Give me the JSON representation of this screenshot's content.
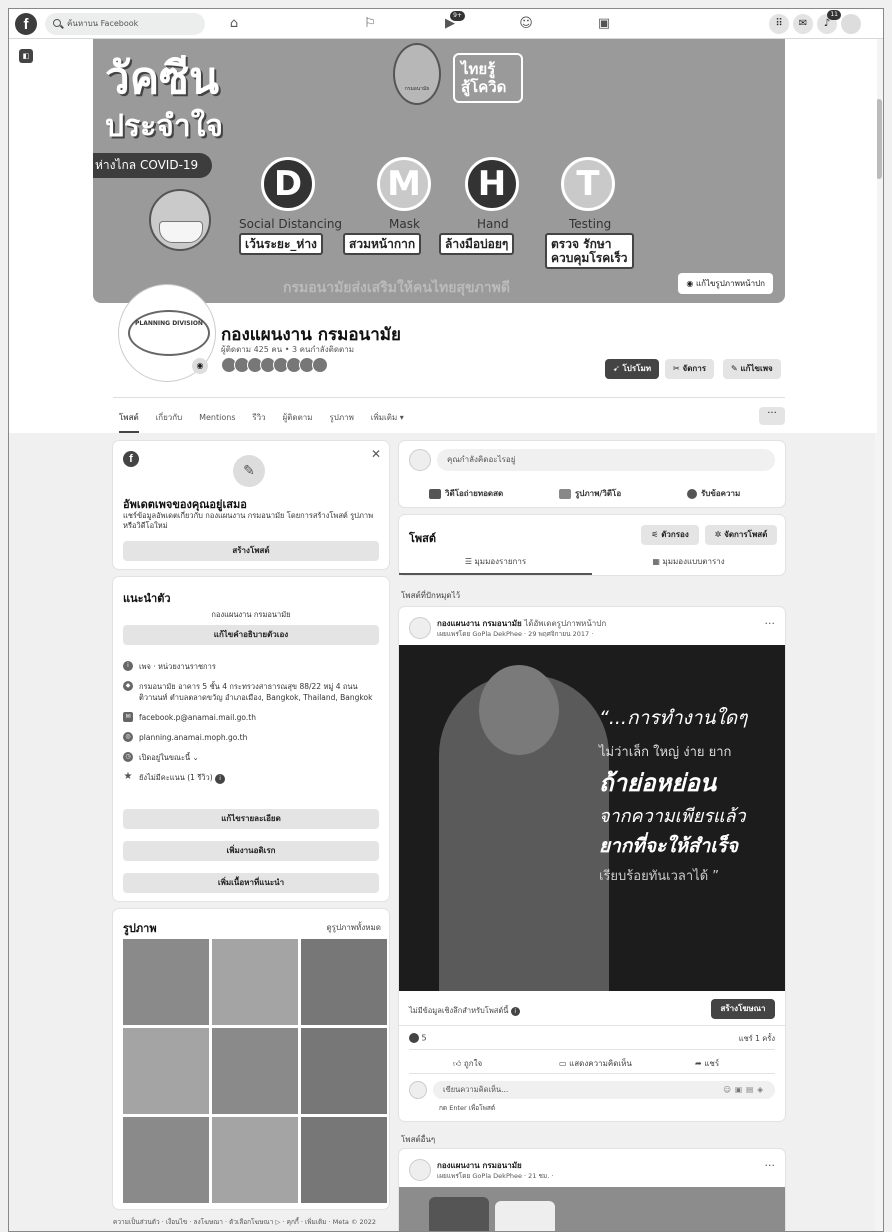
{
  "nav": {
    "search_placeholder": "ค้นหาบน Facebook",
    "badges": {
      "watch": "9+",
      "notifications": "11"
    }
  },
  "cover": {
    "headline1": "วัคซีน",
    "headline2": "ประจำใจ",
    "pill": "ห่างไกล COVID-19",
    "seal_text": "กรมอนามัย",
    "campaign": "ไทยรู้\nสู้โควิด",
    "letters": [
      "D",
      "M",
      "H",
      "T"
    ],
    "english_labels": [
      "Social Distancing",
      "Mask",
      "Hand",
      "Testing"
    ],
    "thai_labels": [
      "เว้นระยะ_ห่าง",
      "สวมหน้ากาก",
      "ล้างมือบ่อยๆ",
      "ตรวจ รักษา\nควบคุมโรคเร็ว"
    ],
    "footer_text": "กรมอนามัยส่งเสริมให้คนไทยสุขภาพดี",
    "edit_button": "แก้ไขรูปภาพหน้าปก"
  },
  "profile": {
    "avatar_text": "PLANNING DIVISION",
    "name": "กองแผนงาน กรมอนามัย",
    "followers": "ผู้ติดตาม 425 คน • 3 คนกำลังติดตาม",
    "promote": "โปรโมท",
    "manage": "จัดการ",
    "edit_page": "แก้ไขเพจ"
  },
  "tabs": [
    "โพสต์",
    "เกี่ยวกับ",
    "Mentions",
    "รีวิว",
    "ผู้ติดตาม",
    "รูปภาพ",
    "เพิ่มเติม ▾"
  ],
  "update_card": {
    "title": "อัพเดตเพจของคุณอยู่เสมอ",
    "body": "แชร์ข้อมูลอัพเดตเกี่ยวกับ กองแผนงาน กรมอนามัย โดยการสร้างโพสต์ รูปภาพ หรือวิดีโอใหม่",
    "button": "สร้างโพสต์"
  },
  "intro": {
    "title": "แนะนำตัว",
    "subtitle": "กองแผนงาน กรมอนามัย",
    "edit_bio": "แก้ไขคำอธิบายตัวเอง",
    "rows": [
      "เพจ · หน่วยงานราชการ",
      "กรมอนามัย อาคาร 5 ชั้น 4 กระทรวงสาธารณสุข 88/22 หมู่ 4 ถนนติวานนท์ ตำบลตลาดขวัญ อำเภอเมือง, Bangkok, Thailand, Bangkok",
      "facebook.p@anamai.mail.go.th",
      "planning.anamai.moph.go.th",
      "เปิดอยู่ในขณะนี้ ⌄",
      "ยังไม่มีคะแนน (1 รีวิว)"
    ],
    "buttons": [
      "แก้ไขรายละเอียด",
      "เพิ่มงานอดิเรก",
      "เพิ่มเนื้อหาที่แนะนำ"
    ]
  },
  "photos": {
    "title": "รูปภาพ",
    "see_all": "ดูรูปภาพทั้งหมด"
  },
  "footer_links": "ความเป็นส่วนตัว · เงื่อนไข · ลงโฆษณา · ตัวเลือกโฆษณา ▷ · คุกกี้ · เพิ่มเติม · Meta © 2022",
  "composer": {
    "placeholder": "คุณกำลังคิดอะไรอยู่",
    "actions": [
      "วิดีโอถ่ายทอดสด",
      "รูปภาพ/วิดีโอ",
      "รับข้อความ"
    ]
  },
  "posts_header": {
    "title": "โพสต์",
    "filter": "ตัวกรอง",
    "manage": "จัดการโพสต์",
    "list_view": "☰ มุมมองรายการ",
    "grid_view": "มุมมองแบบตาราง"
  },
  "pinned": {
    "label": "โพสต์ที่ปักหมุดไว้",
    "author": "กองแผนงาน กรมอนามัย",
    "action": "ได้อัพเดตรูปภาพหน้าปก",
    "meta": "เผยแพร่โดย GoPla DekPhee · 29 พฤศจิกายน 2017 ·",
    "quote": [
      "“...การทำงานใดๆ",
      "ไม่ว่าเล็ก ใหญ่ ง่าย ยาก",
      "ถ้าย่อหย่อน",
      "จากความเพียรแล้ว",
      "ยากที่จะให้สำเร็จ",
      "เรียบร้อยทันเวลาได้ ”"
    ],
    "no_insights": "ไม่มีข้อมูลเชิงลึกสำหรับโพสต์นี้",
    "create_ad": "สร้างโฆษณา",
    "reactions": "5",
    "shares": "แชร์ 1 ครั้ง",
    "like": "ถูกใจ",
    "comment": "แสดงความคิดเห็น",
    "share": "แชร์",
    "comment_placeholder": "เขียนความคิดเห็น...",
    "enter_hint": "กด Enter เพื่อโพสต์"
  },
  "other": {
    "label": "โพสต์อื่นๆ",
    "author": "กองแผนงาน กรมอนามัย",
    "meta": "เผยแพร่โดย GoPla DekPhee · 21 ชม. ·"
  }
}
